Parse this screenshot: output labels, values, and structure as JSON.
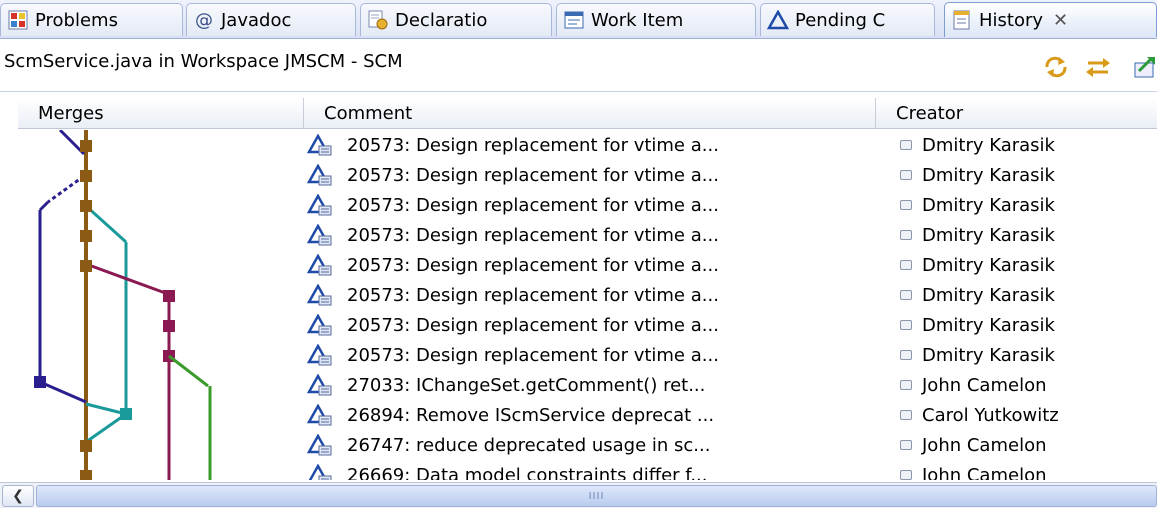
{
  "tabs": [
    {
      "label": "Problems",
      "icon": "problems-icon",
      "active": false
    },
    {
      "label": "Javadoc",
      "icon": "at-sign-icon",
      "active": false
    },
    {
      "label": "Declaratio",
      "icon": "declaration-icon",
      "active": false
    },
    {
      "label": "Work Item",
      "icon": "work-item-icon",
      "active": false
    },
    {
      "label": "Pending C",
      "icon": "delta-icon",
      "active": false
    },
    {
      "label": "History",
      "icon": "history-icon",
      "active": true
    }
  ],
  "close_glyph": "✕",
  "path": "ScmService.java in Workspace JMSCM - SCM",
  "toolbar": [
    "sync-icon",
    "compare-icon",
    "export-icon"
  ],
  "columns": {
    "merges": "Merges",
    "comment": "Comment",
    "creator": "Creator"
  },
  "rows": [
    {
      "comment": "20573: Design replacement for vtime a...",
      "creator": "Dmitry Karasik"
    },
    {
      "comment": "20573: Design replacement for vtime a...",
      "creator": "Dmitry Karasik"
    },
    {
      "comment": "20573: Design replacement for vtime a...",
      "creator": "Dmitry Karasik"
    },
    {
      "comment": "20573: Design replacement for vtime a...",
      "creator": "Dmitry Karasik"
    },
    {
      "comment": "20573: Design replacement for vtime a...",
      "creator": "Dmitry Karasik"
    },
    {
      "comment": "20573: Design replacement for vtime a...",
      "creator": "Dmitry Karasik"
    },
    {
      "comment": "20573: Design replacement for vtime a...",
      "creator": "Dmitry Karasik"
    },
    {
      "comment": "20573: Design replacement for vtime a...",
      "creator": "Dmitry Karasik"
    },
    {
      "comment": "27033: IChangeSet.getComment() ret...",
      "creator": "John Camelon"
    },
    {
      "comment": "26894: Remove IScmService deprecat ...",
      "creator": "Carol Yutkowitz"
    },
    {
      "comment": "26747: reduce deprecated usage in sc...",
      "creator": "John Camelon"
    },
    {
      "comment": "26669: Data model constraints differ f...",
      "creator": "John Camelon"
    }
  ],
  "colors": {
    "brown": "#8b5a14",
    "navy": "#2a1f8f",
    "teal": "#1a9a9a",
    "maroon": "#8b1a52",
    "green": "#3a9a2a",
    "tab_border": "#a9b8d8"
  },
  "scroll_grip": "IIII"
}
